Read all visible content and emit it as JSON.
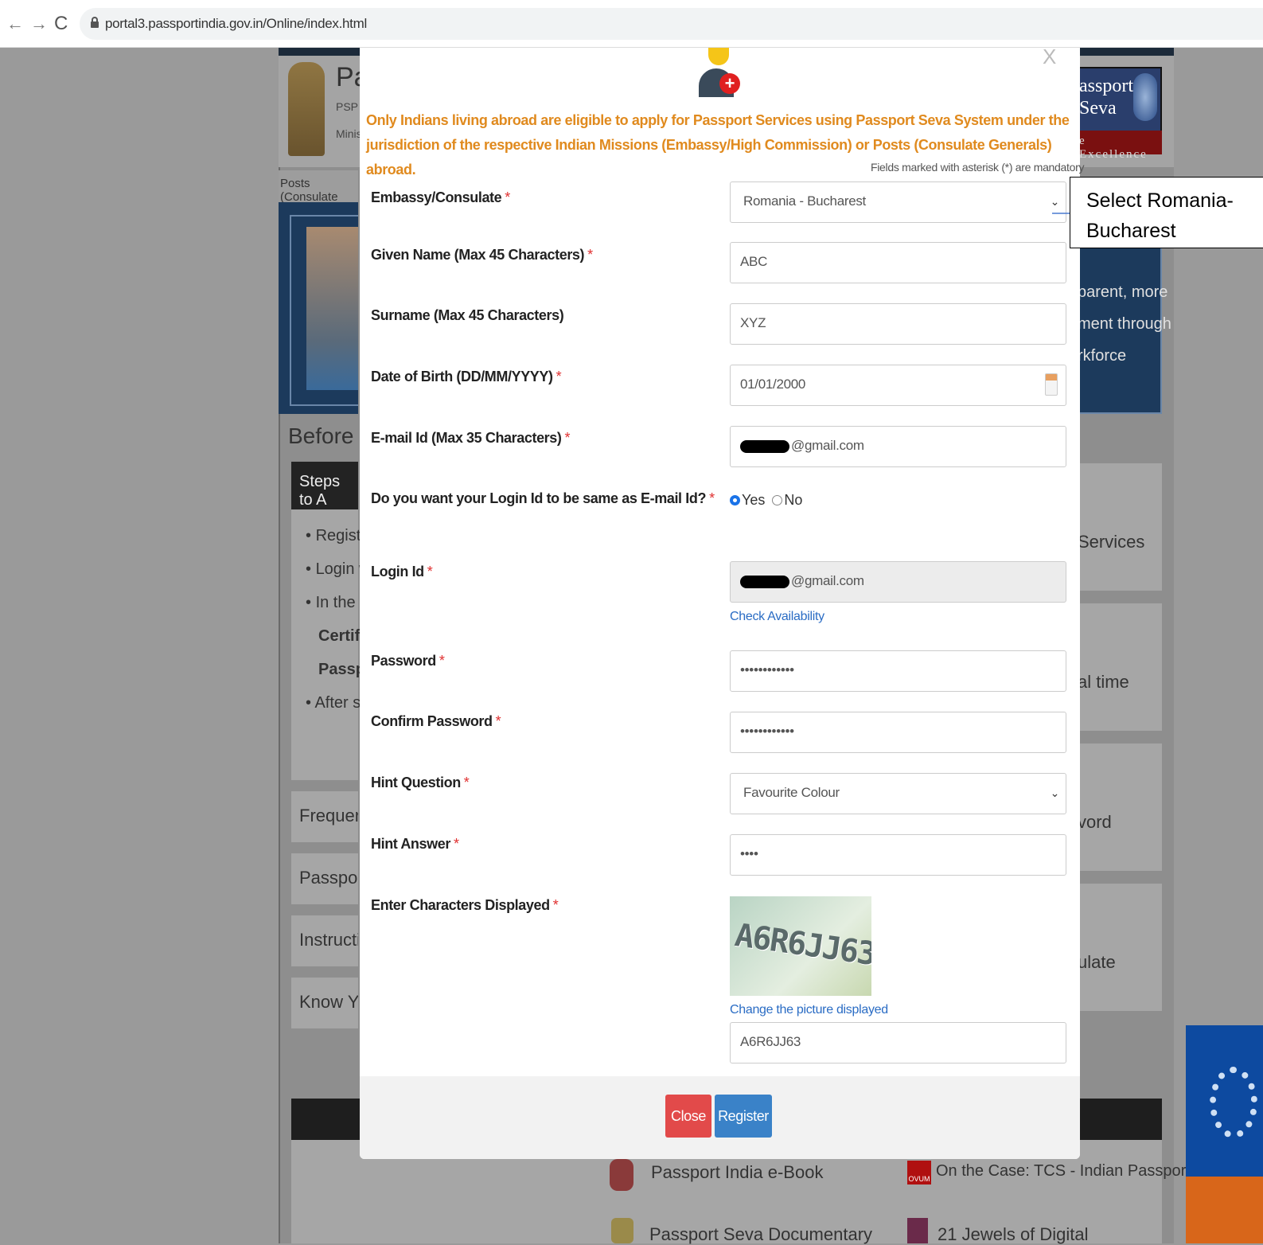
{
  "browser": {
    "back": "←",
    "forward": "→",
    "reload": "C",
    "url": "portal3.passportindia.gov.in/Online/index.html"
  },
  "background_site": {
    "header_title": "Pa",
    "header_psp": "PSP",
    "header_ministry": "Minis",
    "posts_bar": "Posts (Consulate",
    "before_you": "Before Yo",
    "steps_title": "Steps to A",
    "steps_items": [
      "Registe",
      "Login w",
      "In  the",
      "Certific",
      "Passpo",
      "After su"
    ],
    "side_links": [
      "Frequently",
      "Passport A",
      "Instruction",
      "Know You"
    ],
    "logo_line1": "assport",
    "logo_line2": "Seva",
    "logo_excellence": "e Excellence",
    "right_blue_lines": [
      "parent,  more",
      "ment  through",
      "rkforce"
    ],
    "right_cards": [
      "Services",
      "al time",
      "vord",
      "ulate"
    ],
    "bottom_items": [
      "Passport India e-Book",
      "On the Case: TCS - Indian Passport Office",
      "Passport Seva Documentary",
      "21 Jewels of Digital"
    ],
    "ovum_label": "OVUM"
  },
  "modal": {
    "close_x": "X",
    "notice": "Only Indians living abroad are eligible to apply for Passport Services using Passport Seva System under the jurisdiction of the respective Indian Missions (Embassy/High Commission) or Posts (Consulate Generals) abroad.",
    "mandatory_note": "Fields marked with asterisk (*) are mandatory",
    "required_mark": "*",
    "fields": {
      "embassy": {
        "label": "Embassy/Consulate",
        "value": "Romania - Bucharest"
      },
      "given_name": {
        "label": "Given Name (Max 45 Characters)",
        "value": "ABC"
      },
      "surname": {
        "label": "Surname (Max 45 Characters)",
        "value": "XYZ"
      },
      "dob": {
        "label": "Date of Birth (DD/MM/YYYY)",
        "value": "01/01/2000"
      },
      "email": {
        "label": "E-mail Id (Max 35 Characters)",
        "value": "@gmail.com"
      },
      "login_same": {
        "label": "Do you want your Login Id to be same as E-mail Id?",
        "yes": "Yes",
        "no": "No",
        "selected": "Yes"
      },
      "login_id": {
        "label": "Login Id",
        "value": "@gmail.com",
        "check_link": "Check Availability"
      },
      "password": {
        "label": "Password",
        "value": "••••••••••••"
      },
      "confirm_password": {
        "label": "Confirm Password",
        "value": "••••••••••••"
      },
      "hint_question": {
        "label": "Hint Question",
        "value": "Favourite Colour"
      },
      "hint_answer": {
        "label": "Hint Answer",
        "value": "••••"
      },
      "captcha": {
        "label": "Enter Characters Displayed",
        "image_text": "A6R6JJ63",
        "change_link": "Change the picture displayed",
        "value": "A6R6JJ63"
      }
    },
    "buttons": {
      "close": "Close",
      "register": "Register"
    }
  },
  "annotation": {
    "line1": "Select Romania-",
    "line2": "Bucharest"
  },
  "colors": {
    "notice": "#e08a1e",
    "required": "#e03030",
    "link": "#2a6cc4",
    "close_button": "#e24a4a",
    "register_button": "#3a82c8"
  }
}
